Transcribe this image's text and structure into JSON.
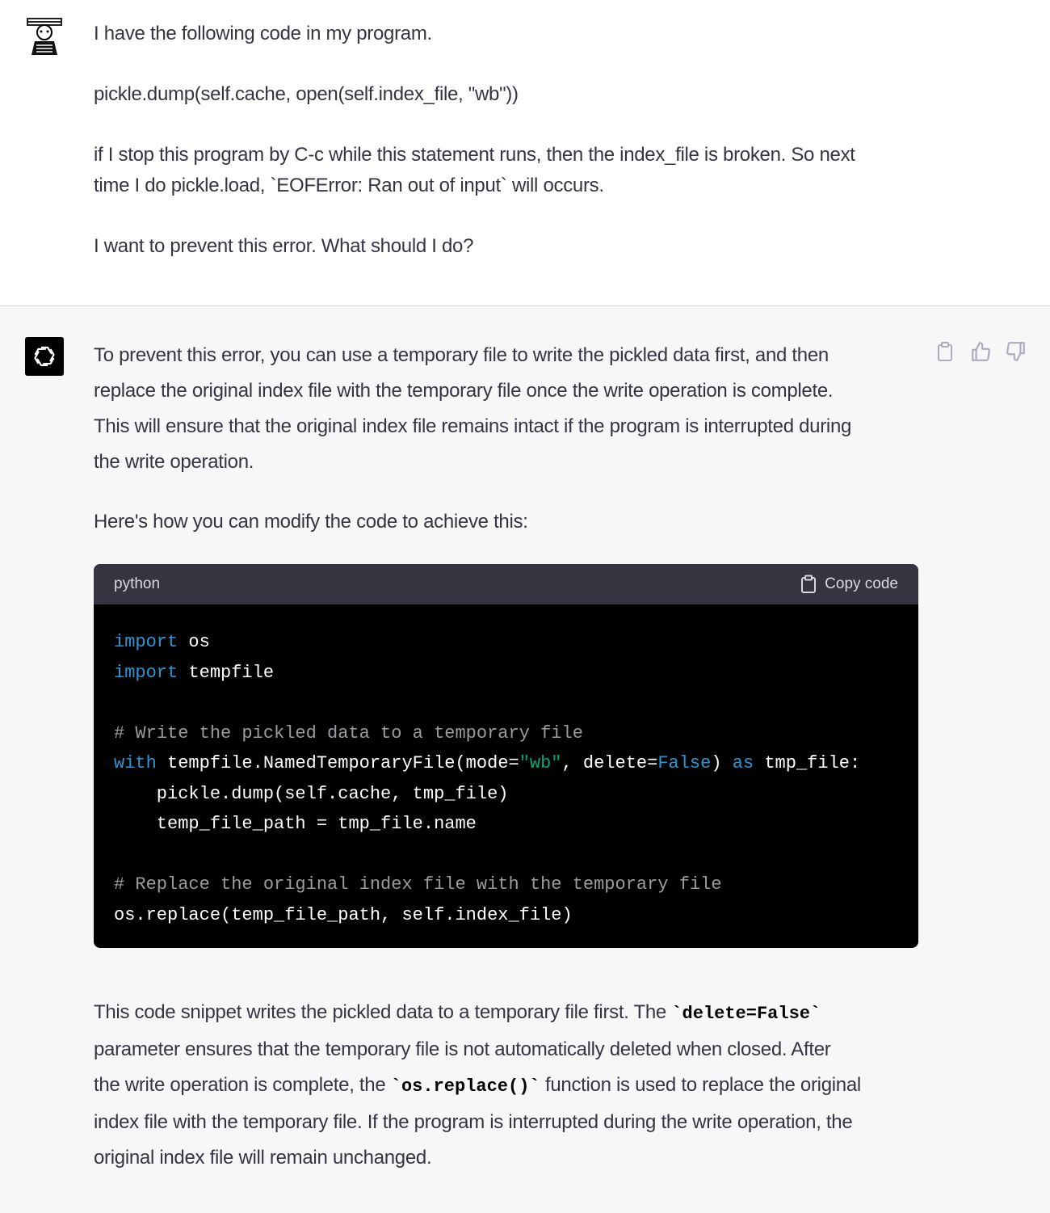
{
  "user": {
    "lines": [
      "I have the following code in my program.",
      "pickle.dump(self.cache, open(self.index_file, \"wb\"))",
      "if I stop this program by C-c while this statement runs, then the index_file is broken.  So next",
      "time I do pickle.load,  `EOFError: Ran out of input`  will occurs.",
      "I want to prevent this error.  What should I do?"
    ]
  },
  "assistant": {
    "intro": [
      "To prevent this error, you can use a temporary file to write the pickled data first, and then",
      "replace the original index file with the temporary file once the write operation is complete.",
      "This will ensure that the original index file remains intact if the program is interrupted during",
      "the write operation."
    ],
    "lead": "Here's how you can modify the code to achieve this:",
    "code": {
      "language": "python",
      "copy_label": "Copy code",
      "t": {
        "import": "import",
        "os": " os",
        "tempfile": " tempfile",
        "comment1": "# Write the pickled data to a temporary file",
        "with": "with",
        "ntf": " tempfile.NamedTemporaryFile(mode=",
        "wb": "\"wb\"",
        "delete": ", delete=",
        "false": "False",
        "close": ") ",
        "as": "as",
        "tmp": " tmp_file:",
        "dump": "    pickle.dump(self.cache, tmp_file)",
        "path": "    temp_file_path = tmp_file.name",
        "comment2": "# Replace the original index file with the temporary file",
        "replace": "os.replace(temp_file_path, self.index_file)"
      }
    },
    "outro": {
      "l1a": "This code snippet writes the pickled data to a temporary file first. The ",
      "code1": "`delete=False`",
      "l2": "parameter ensures that the temporary file is not automatically deleted when closed. After",
      "l3a": "the write operation is complete, the ",
      "code2": "`os.replace()`",
      "l3b": " function is used to replace the original",
      "l4": "index file with the temporary file. If the program is interrupted during the write operation, the",
      "l5": "original index file will remain unchanged."
    },
    "actions": [
      "clipboard-icon",
      "thumbs-up-icon",
      "thumbs-down-icon"
    ]
  }
}
